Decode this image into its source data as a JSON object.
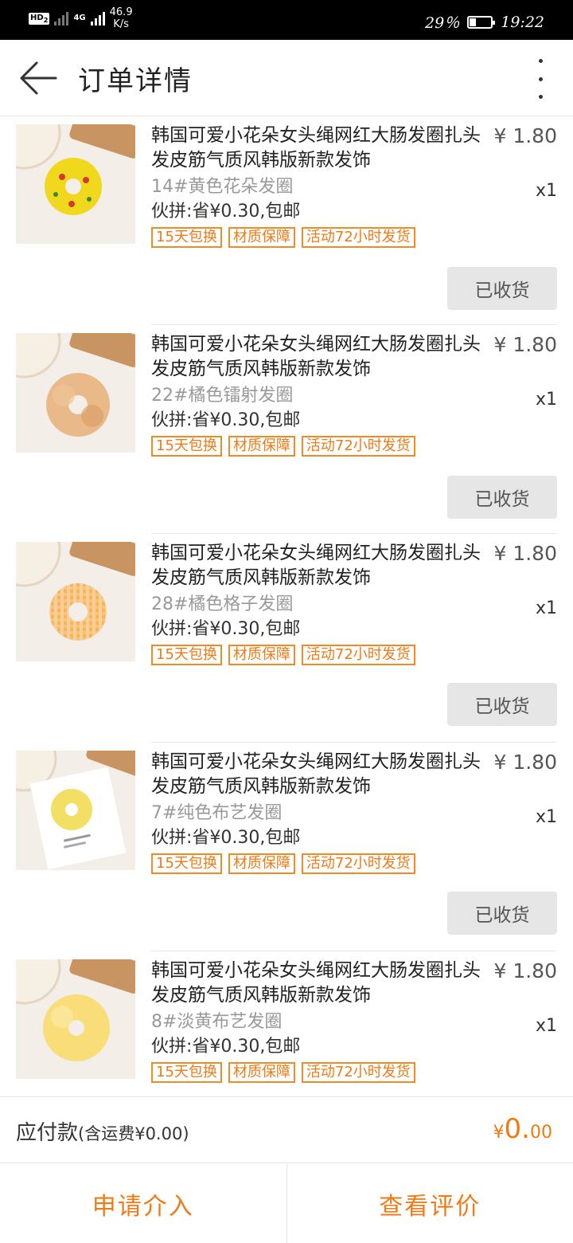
{
  "status_bar": {
    "hd": "HD",
    "hd_sub": "2",
    "net": "4G",
    "speed_value": "46.9",
    "speed_unit": "K/s",
    "battery": "29％",
    "time": "19:22"
  },
  "header": {
    "title": "订单详情"
  },
  "colors": {
    "accent": "#f07a14",
    "button_gray": "#e6e6e6"
  },
  "items": [
    {
      "title": "韩国可爱小花朵女头绳网红大肠发圈扎头发皮筋气质风韩版新款发饰",
      "price": "¥ 1.80",
      "variant": "14#黄色花朵发圈",
      "quantity": "x1",
      "deal": "伙拼:省¥0.30,包邮",
      "tags": [
        "15天包换",
        "材质保障",
        "活动72小时发货"
      ],
      "status_button": "已收货",
      "image_icon": "yellow-flower-scrunchie-photo"
    },
    {
      "title": "韩国可爱小花朵女头绳网红大肠发圈扎头发皮筋气质风韩版新款发饰",
      "price": "¥ 1.80",
      "variant": "22#橘色镭射发圈",
      "quantity": "x1",
      "deal": "伙拼:省¥0.30,包邮",
      "tags": [
        "15天包换",
        "材质保障",
        "活动72小时发货"
      ],
      "status_button": "已收货",
      "image_icon": "orange-laser-scrunchie-photo"
    },
    {
      "title": "韩国可爱小花朵女头绳网红大肠发圈扎头发皮筋气质风韩版新款发饰",
      "price": "¥ 1.80",
      "variant": "28#橘色格子发圈",
      "quantity": "x1",
      "deal": "伙拼:省¥0.30,包邮",
      "tags": [
        "15天包换",
        "材质保障",
        "活动72小时发货"
      ],
      "status_button": "已收货",
      "image_icon": "orange-plaid-scrunchie-photo"
    },
    {
      "title": "韩国可爱小花朵女头绳网红大肠发圈扎头发皮筋气质风韩版新款发饰",
      "price": "¥ 1.80",
      "variant": "7#纯色布艺发圈",
      "quantity": "x1",
      "deal": "伙拼:省¥0.30,包邮",
      "tags": [
        "15天包换",
        "材质保障",
        "活动72小时发货"
      ],
      "status_button": "已收货",
      "image_icon": "yellow-fabric-scrunchie-photo"
    },
    {
      "title": "韩国可爱小花朵女头绳网红大肠发圈扎头发皮筋气质风韩版新款发饰",
      "price": "¥ 1.80",
      "variant": "8#淡黄布艺发圈",
      "quantity": "x1",
      "deal": "伙拼:省¥0.30,包邮",
      "tags": [
        "15天包换",
        "材质保障",
        "活动72小时发货"
      ],
      "status_button": "",
      "image_icon": "light-yellow-scrunchie-photo"
    }
  ],
  "summary": {
    "label": "应付款",
    "shipping_note": "(含运费¥0.00)",
    "currency": "¥",
    "amount_int": "0.",
    "amount_dec": "00"
  },
  "actions": {
    "apply_intervene": "申请介入",
    "view_review": "查看评价"
  }
}
